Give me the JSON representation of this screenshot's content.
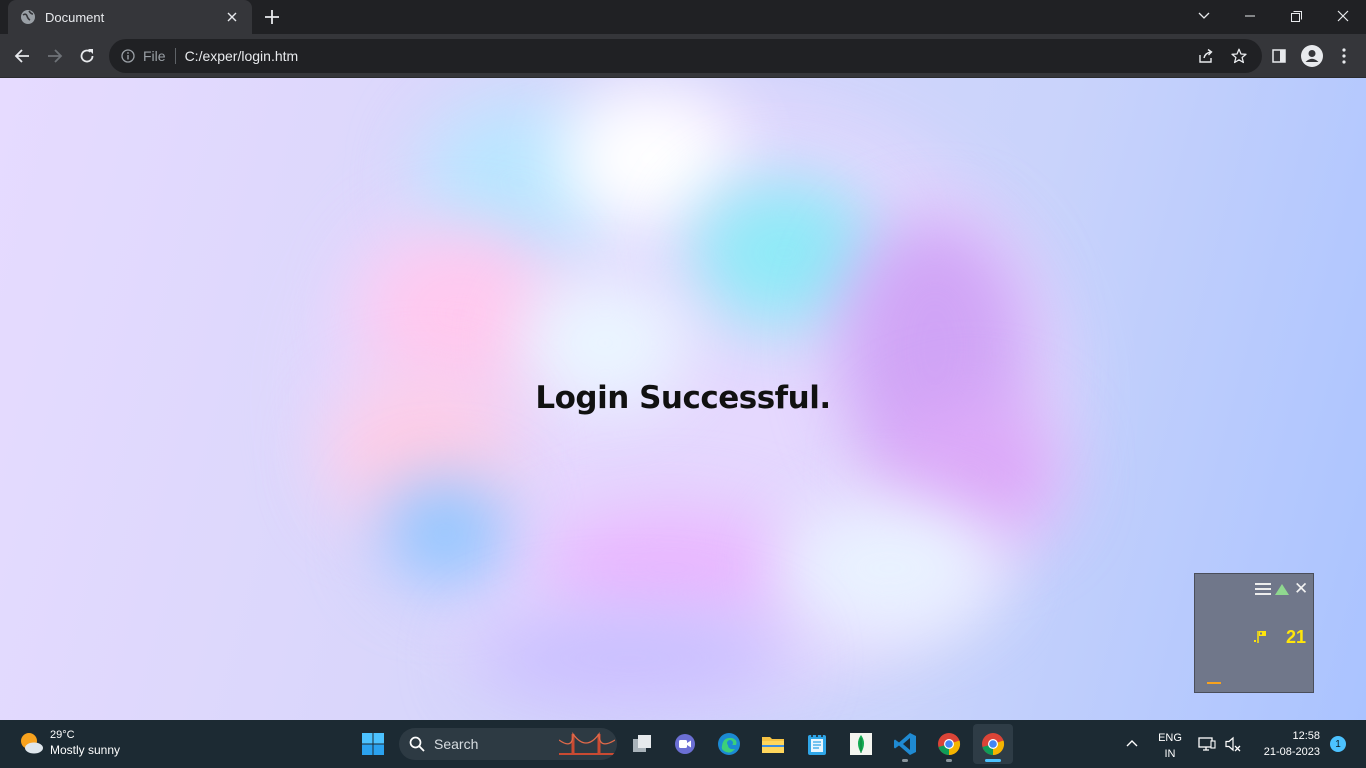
{
  "browser": {
    "tab": {
      "title": "Document"
    },
    "address_bar": {
      "scheme_label": "File",
      "url": "C:/exper/login.htm"
    }
  },
  "page": {
    "headline": "Login Successful.",
    "widget": {
      "count": "21"
    }
  },
  "taskbar": {
    "weather": {
      "temperature": "29°C",
      "description": "Mostly sunny"
    },
    "search": {
      "label": "Search"
    },
    "pinned_apps": [
      "File Explorer (task view)",
      "Teams Meet",
      "Microsoft Edge",
      "File Explorer",
      "Notepad",
      "MongoDB Compass",
      "Visual Studio Code",
      "Google Chrome",
      "Google Chrome"
    ],
    "tray": {
      "language": "ENG",
      "region": "IN"
    },
    "clock": {
      "time": "12:58",
      "date": "21-08-2023"
    },
    "notification_count": "1"
  },
  "colors": {
    "chrome_dark": "#202124",
    "chrome_toolbar": "#35363a",
    "taskbar": "#1c2a33",
    "accent": "#4cc2ff",
    "widget_count": "#ffe60a"
  }
}
